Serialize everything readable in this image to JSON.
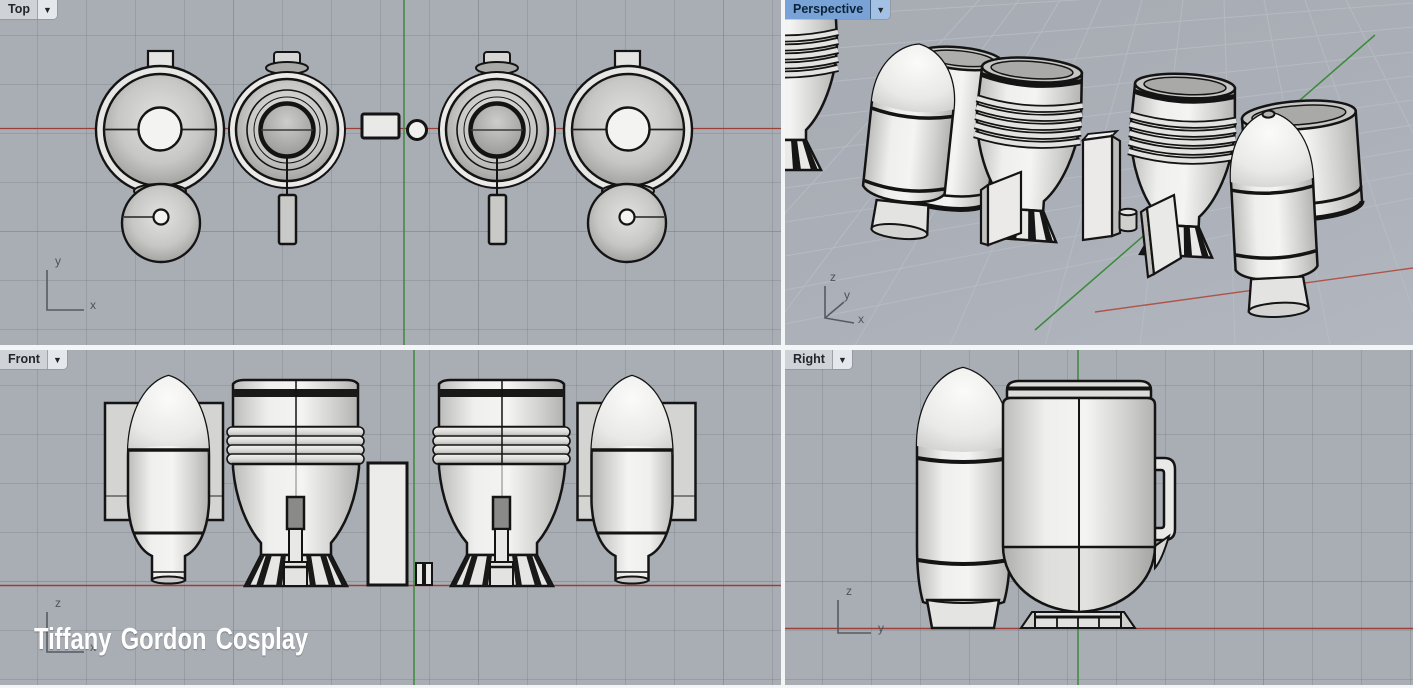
{
  "viewports": {
    "top": {
      "label": "Top",
      "active": false,
      "axes": {
        "up": "y",
        "right": "x"
      }
    },
    "perspective": {
      "label": "Perspective",
      "active": true,
      "axes": {
        "up": "z",
        "mid": "y",
        "right": "x"
      }
    },
    "front": {
      "label": "Front",
      "active": false,
      "axes": {
        "up": "z",
        "right": "x"
      }
    },
    "right": {
      "label": "Right",
      "active": false,
      "axes": {
        "up": "z",
        "right": "y"
      }
    }
  },
  "icons": {
    "dropdown": "▼"
  },
  "watermark": {
    "text": "Tiffany Gordon Cosplay",
    "color": "#ffffff"
  },
  "scene": {
    "description": "Grayscale 3D rocket / jet-pack parts shown in four views",
    "object_count_perspective": 9
  },
  "colors": {
    "viewport_bg": "#a9adb4",
    "gutter": "#f3f5f7",
    "grid_line": "#888d95",
    "axis_x_red": "#9a4038",
    "axis_y_green": "#3c8a3c",
    "outline": "#141414",
    "model_fill": "#e8e8e6",
    "tab_bg": "#d3d6da",
    "tab_active_bg": "#79a3d6"
  }
}
